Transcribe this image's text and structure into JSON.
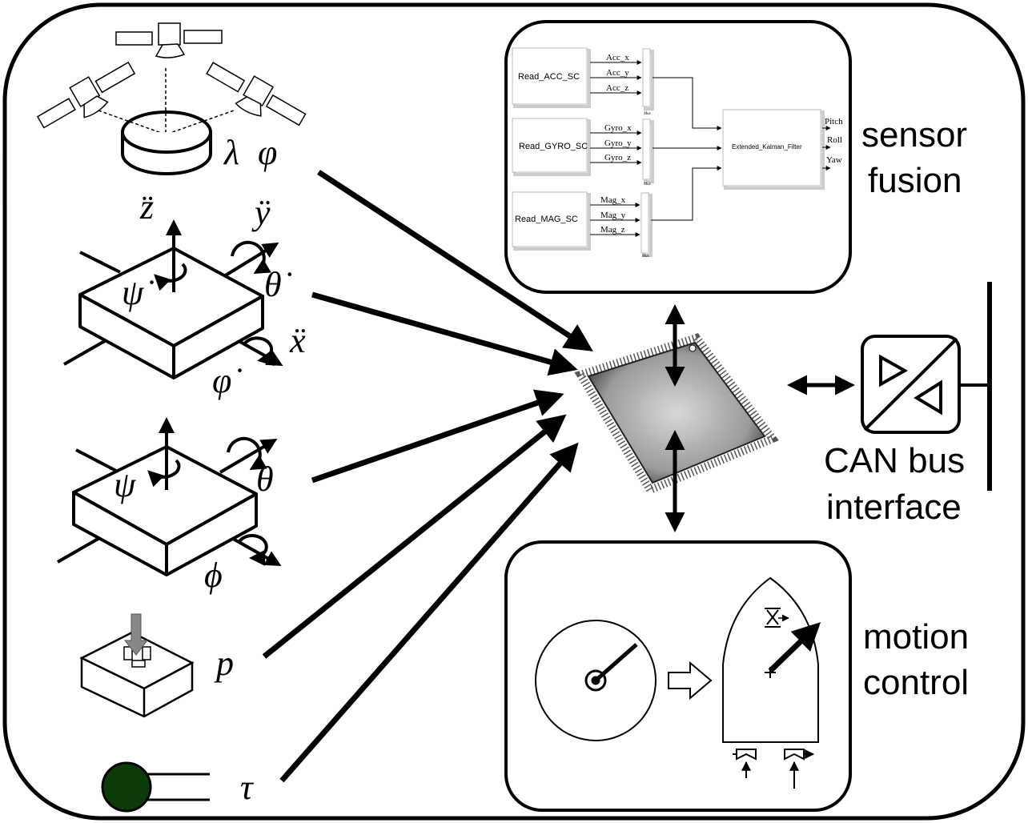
{
  "sensor_fusion": {
    "label_line1": "sensor",
    "label_line2": "fusion",
    "blocks": {
      "acc": "Read_ACC_SC",
      "gyro": "Read_GYRO_SC",
      "mag": "Read_MAG_SC",
      "ekf": "Extended_Kalman_Filter",
      "mux": "Mux"
    },
    "signals": {
      "acc": [
        "Acc_x",
        "Acc_y",
        "Acc_z"
      ],
      "gyro": [
        "Gyro_x",
        "Gyro_y",
        "Gyro_z"
      ],
      "mag": [
        "Mag_x",
        "Mag_y",
        "Mag_z"
      ],
      "outputs": [
        "Pitch",
        "Roll",
        "Yaw"
      ]
    }
  },
  "can": {
    "label_line1": "CAN bus",
    "label_line2": "interface"
  },
  "motion": {
    "label_line1": "motion",
    "label_line2": "control"
  },
  "sensors": {
    "gps": {
      "lambda": "λ",
      "phi": "φ"
    },
    "imu_accel": {
      "zdd": "z̈",
      "ydd": "ÿ",
      "xdd": "ẍ",
      "psid": "ψ̇",
      "thetad": "θ̇",
      "phid": "φ̇"
    },
    "imu_angle": {
      "psi": "ψ",
      "theta": "θ",
      "phi": "ϕ"
    },
    "pressure": "p",
    "temperature": "τ"
  },
  "colors": {
    "thermo_ball": "#0b3a0b",
    "line": "#000000"
  }
}
